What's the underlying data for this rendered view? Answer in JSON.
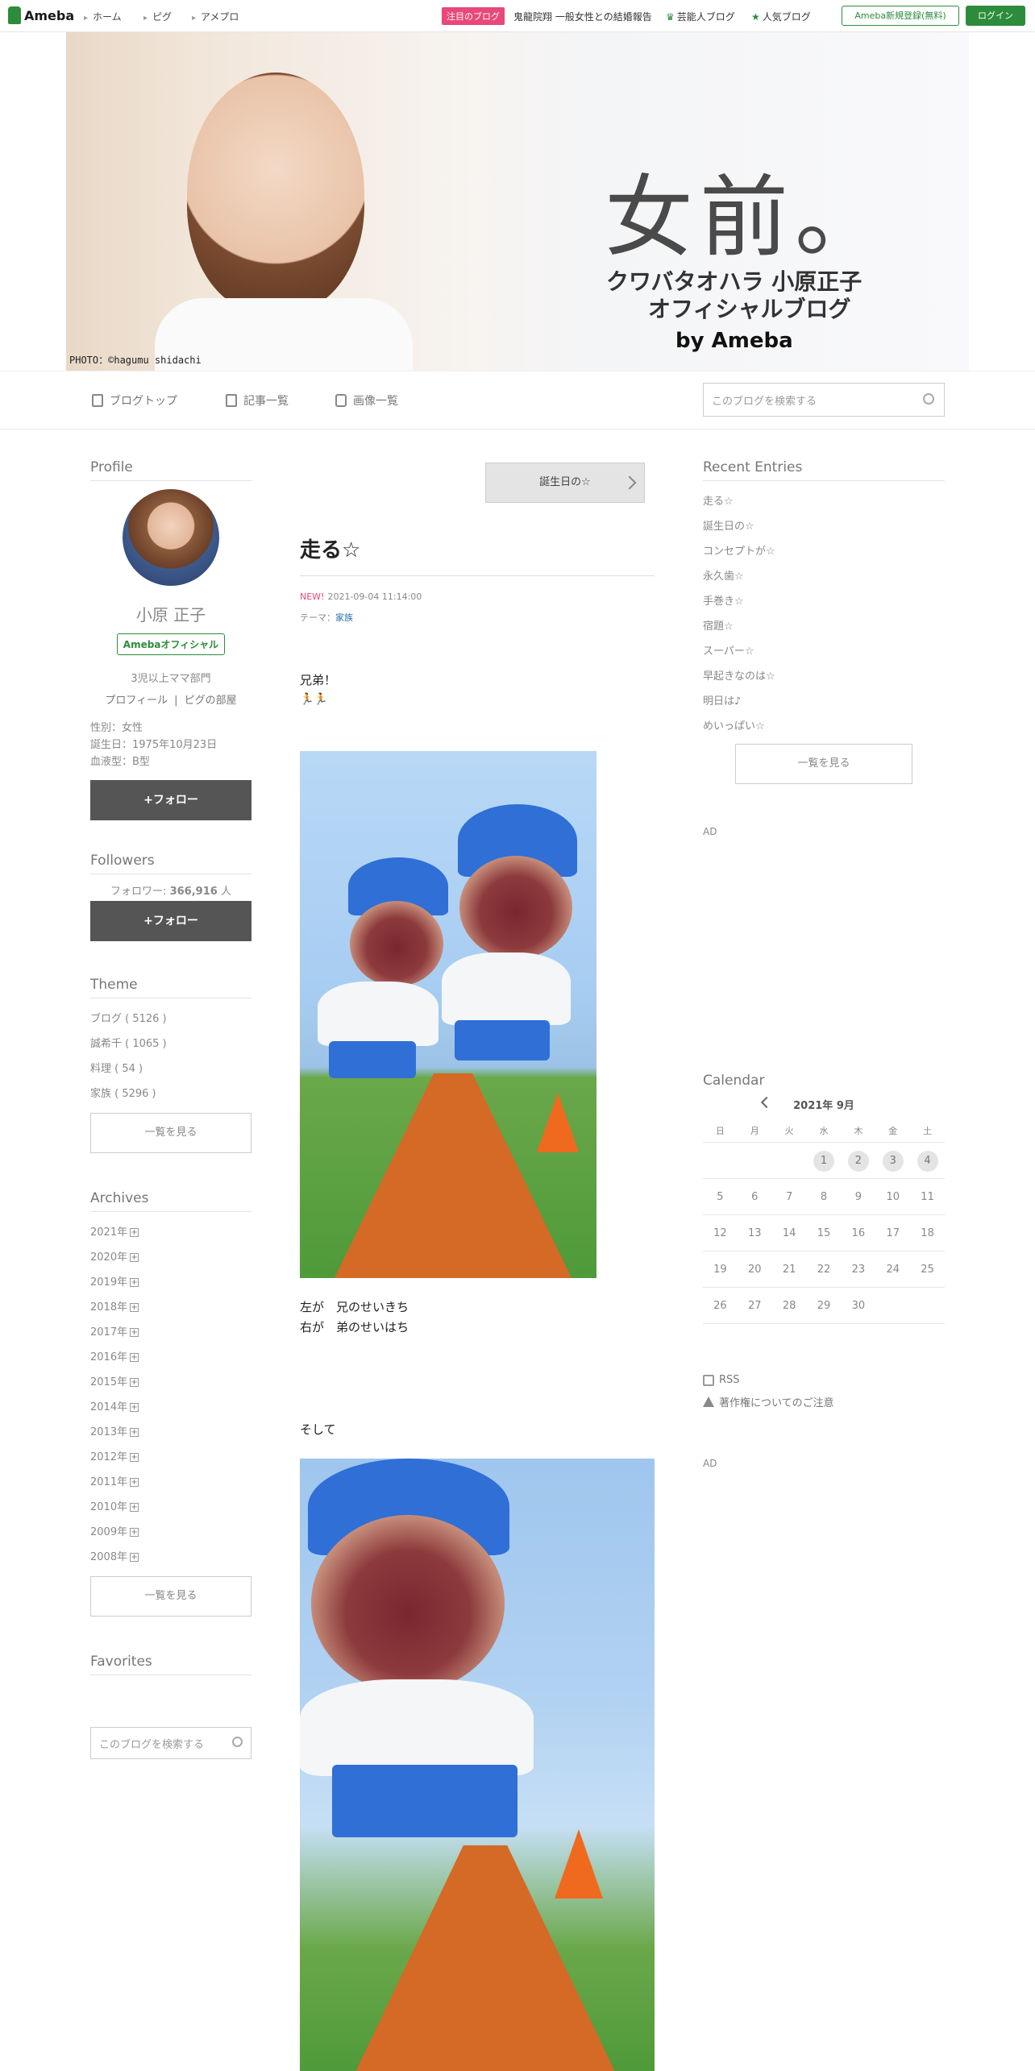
{
  "topbar": {
    "logo": "Ameba",
    "nav": [
      "ホーム",
      "ピグ",
      "アメプロ"
    ],
    "pickup_badge": "注目のブログ",
    "pickup_text": "鬼龍院翔 一般女性との結婚報告",
    "celeb_blog": "芸能人ブログ",
    "popular_blog": "人気ブログ",
    "register": "Ameba新規登録(無料)",
    "login": "ログイン"
  },
  "header": {
    "title": "女前。",
    "subtitle_line1": "クワバタオハラ 小原正子",
    "subtitle_line2": "オフィシャルブログ",
    "by": "by Ameba",
    "photo_credit": "PHOTO：©hagumu shidachi"
  },
  "subnav": {
    "blog_top": "ブログトップ",
    "entries": "記事一覧",
    "images": "画像一覧",
    "search_placeholder": "このブログを検索する"
  },
  "profile": {
    "section_title": "Profile",
    "name": "小原 正子",
    "badge": "Amebaオフィシャル",
    "description": "3児以上ママ部門",
    "link_profile": "プロフィール",
    "link_room": "ピグの部屋",
    "gender": "性別：女性",
    "birthday": "誕生日：1975年10月23日",
    "blood": "血液型：B型",
    "follow": "+フォロー"
  },
  "followers": {
    "section_title": "Followers",
    "label": "フォロワー:",
    "count": "366,916",
    "unit": "人",
    "follow": "+フォロー"
  },
  "theme_section": {
    "section_title": "Theme",
    "items": [
      "ブログ ( 5126 )",
      "誠希千 ( 1065 )",
      "料理 ( 54 )",
      "家族 ( 5296 )"
    ],
    "see_all": "一覧を見る"
  },
  "archives": {
    "section_title": "Archives",
    "years": [
      "2021年",
      "2020年",
      "2019年",
      "2018年",
      "2017年",
      "2016年",
      "2015年",
      "2014年",
      "2013年",
      "2012年",
      "2011年",
      "2010年",
      "2009年",
      "2008年"
    ],
    "see_all": "一覧を見る"
  },
  "favorites": {
    "section_title": "Favorites",
    "search_placeholder": "このブログを検索する"
  },
  "article": {
    "next_post": "誕生日の☆",
    "title": "走る☆",
    "new_label": "NEW!",
    "datetime": "2021-09-04 11:14:00",
    "theme_label": "テーマ：",
    "theme": "家族",
    "line1": "兄弟！",
    "emoji": "🏃🏃",
    "caption1": "左が　兄のせいきち",
    "caption2": "右が　弟のせいはち",
    "line2": "そして"
  },
  "recent": {
    "section_title": "Recent Entries",
    "items": [
      "走る☆",
      "誕生日の☆",
      "コンセプトが☆",
      "永久歯☆",
      "手巻き☆",
      "宿題☆",
      "スーパー☆",
      "早起きなのは☆",
      "明日は♪",
      "めいっぱい☆"
    ],
    "see_all": "一覧を見る"
  },
  "ad_label": "AD",
  "calendar": {
    "section_title": "Calendar",
    "month": "2021年 9月",
    "weekdays": [
      "日",
      "月",
      "火",
      "水",
      "木",
      "金",
      "土"
    ],
    "days": [
      "",
      "",
      "",
      "1",
      "2",
      "3",
      "4",
      "5",
      "6",
      "7",
      "8",
      "9",
      "10",
      "11",
      "12",
      "13",
      "14",
      "15",
      "16",
      "17",
      "18",
      "19",
      "20",
      "21",
      "22",
      "23",
      "24",
      "25",
      "26",
      "27",
      "28",
      "29",
      "30",
      "",
      ""
    ],
    "highlighted": [
      "1",
      "2",
      "3",
      "4"
    ]
  },
  "footer_links": {
    "rss": "RSS",
    "copyright": "著作権についてのご注意"
  },
  "colors": {
    "brand_green": "#2d8c3c",
    "pickup_pink": "#e8487a",
    "follow_button": "#555555"
  }
}
